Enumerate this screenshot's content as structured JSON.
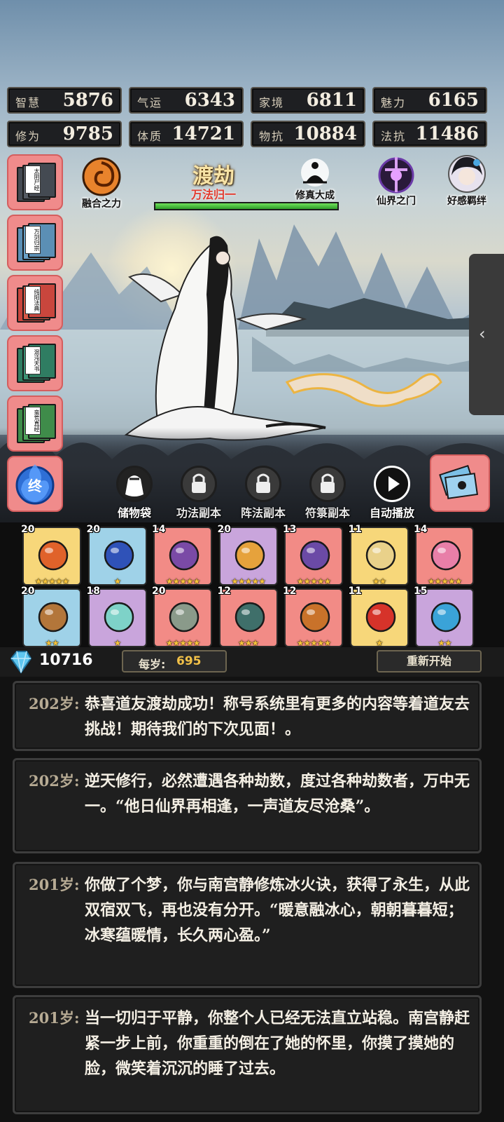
{
  "stats": [
    {
      "label": "智慧",
      "value": "5876"
    },
    {
      "label": "气运",
      "value": "6343"
    },
    {
      "label": "家境",
      "value": "6811"
    },
    {
      "label": "魅力",
      "value": "6165"
    },
    {
      "label": "修为",
      "value": "9785"
    },
    {
      "label": "体质",
      "value": "14721"
    },
    {
      "label": "物抗",
      "value": "10884"
    },
    {
      "label": "法抗",
      "value": "11486"
    }
  ],
  "books": [
    {
      "title": "太阴尸经",
      "color": "#444a52"
    },
    {
      "title": "万剑归宗",
      "color": "#5b8fb5"
    },
    {
      "title": "纯阳法典",
      "color": "#c9463d"
    },
    {
      "title": "混沌天书",
      "color": "#2f7d62"
    },
    {
      "title": "蛮荒真经",
      "color": "#3f8c4a"
    }
  ],
  "top_buttons": {
    "fusion": "融合之力",
    "cultivate_complete": "修真大成",
    "immortal_gate": "仙界之门",
    "affinity": "好感羁绊"
  },
  "realm": {
    "name": "渡劫",
    "sub": "万法归一",
    "progress": 1.0
  },
  "actions": [
    {
      "label": "储物袋",
      "locked": false,
      "icon": "bag-icon"
    },
    {
      "label": "功法副本",
      "locked": true,
      "icon": "lock-icon"
    },
    {
      "label": "阵法副本",
      "locked": true,
      "icon": "lock-icon"
    },
    {
      "label": "符箓副本",
      "locked": true,
      "icon": "lock-icon"
    },
    {
      "label": "自动播放",
      "locked": false,
      "icon": "play-icon"
    }
  ],
  "inventory": [
    {
      "level": "20",
      "stars": 5,
      "bg": "#f7d77a",
      "icon": "ring-icon",
      "accent": "#e0622a"
    },
    {
      "level": "20",
      "stars": 1,
      "bg": "#9fd2e8",
      "icon": "boots-icon",
      "accent": "#2f52b8"
    },
    {
      "level": "14",
      "stars": 5,
      "bg": "#f28b86",
      "icon": "staff-icon",
      "accent": "#7a4aa6"
    },
    {
      "level": "20",
      "stars": 5,
      "bg": "#c9a5dc",
      "icon": "gourd-icon",
      "accent": "#e6a23c"
    },
    {
      "level": "13",
      "stars": 5,
      "bg": "#f28b86",
      "icon": "mirror-icon",
      "accent": "#6b4aa6"
    },
    {
      "level": "11",
      "stars": 2,
      "bg": "#f7d77a",
      "icon": "scepter-icon",
      "accent": "#e9d18a"
    },
    {
      "level": "14",
      "stars": 5,
      "bg": "#f28b86",
      "icon": "scroll-icon",
      "accent": "#e87fa8"
    },
    {
      "level": "20",
      "stars": 2,
      "bg": "#9fd2e8",
      "icon": "sword-icon",
      "accent": "#b3763a"
    },
    {
      "level": "18",
      "stars": 1,
      "bg": "#c9a5dc",
      "icon": "jade-pendant-icon",
      "accent": "#7ed2c8"
    },
    {
      "level": "20",
      "stars": 5,
      "bg": "#f28b86",
      "icon": "axe-icon",
      "accent": "#8a9a8a"
    },
    {
      "level": "12",
      "stars": 3,
      "bg": "#f28b86",
      "icon": "blade-icon",
      "accent": "#3f6f6a"
    },
    {
      "level": "12",
      "stars": 5,
      "bg": "#f28b86",
      "icon": "cauldron-icon",
      "accent": "#c9722a"
    },
    {
      "level": "11",
      "stars": 1,
      "bg": "#f7d77a",
      "icon": "orb-red-icon",
      "accent": "#d6332a"
    },
    {
      "level": "15",
      "stars": 2,
      "bg": "#c9a5dc",
      "icon": "orb-blue-icon",
      "accent": "#3aa3d8"
    }
  ],
  "currency": {
    "gems": "10716",
    "per_year_label": "每岁:",
    "per_year_value": "695",
    "restart": "重新开始"
  },
  "log": [
    {
      "age": "202岁:",
      "text": "恭喜道友渡劫成功！称号系统里有更多的内容等着道友去挑战！期待我们的下次见面！。"
    },
    {
      "age": "202岁:",
      "text": "逆天修行，必然遭遇各种劫数，度过各种劫数者，万中无一。“他日仙界再相逢，一声道友尽沧桑”。"
    },
    {
      "age": "201岁:",
      "text": "你做了个梦，你与南宫静修炼冰火诀，获得了永生，从此双宿双飞，再也没有分开。“暖意融冰心，朝朝暮暮短；冰寒蕴暖情，长久两心盈。”"
    },
    {
      "age": "201岁:",
      "text": "当一切归于平静，你整个人已经无法直立站稳。南宫静赶紧一步上前，你重重的倒在了她的怀里，你摸了摸她的脸，微笑着沉沉的睡了过去。"
    }
  ],
  "colors": {
    "slot_gold": "#f7d77a",
    "slot_blue": "#9fd2e8",
    "slot_red": "#f28b86",
    "slot_purple": "#c9a5dc",
    "star": "#f6c33a",
    "progress_green": "#4cc03c"
  }
}
